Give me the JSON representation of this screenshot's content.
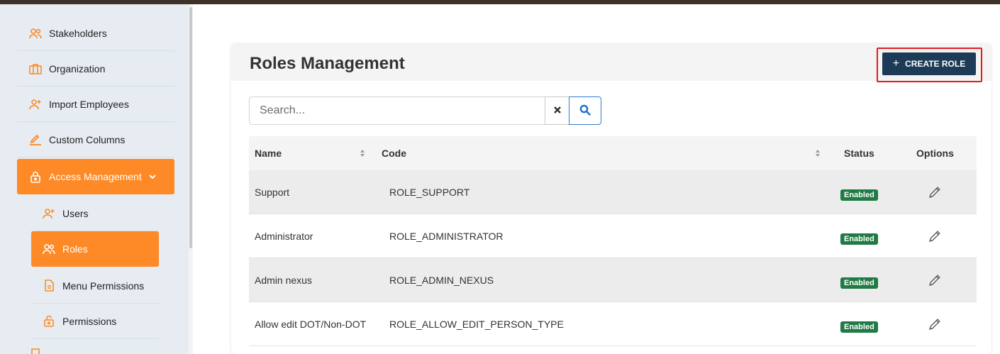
{
  "sidebar": {
    "items": [
      {
        "label": "Stakeholders",
        "icon": "users-icon"
      },
      {
        "label": "Organization",
        "icon": "briefcase-icon"
      },
      {
        "label": "Import Employees",
        "icon": "user-plus-icon"
      },
      {
        "label": "Custom Columns",
        "icon": "pencil-icon"
      },
      {
        "label": "Access Management",
        "icon": "lock-icon"
      },
      {
        "label": "Users",
        "icon": "user-plus-icon"
      },
      {
        "label": "Roles",
        "icon": "users-icon"
      },
      {
        "label": "Menu Permissions",
        "icon": "document-icon"
      },
      {
        "label": "Permissions",
        "icon": "unlock-icon"
      }
    ]
  },
  "page": {
    "title": "Roles Management",
    "create_label": "CREATE ROLE"
  },
  "search": {
    "placeholder": "Search...",
    "value": ""
  },
  "table": {
    "headers": {
      "name": "Name",
      "code": "Code",
      "status": "Status",
      "options": "Options"
    },
    "rows": [
      {
        "name": "Support",
        "code": "ROLE_SUPPORT",
        "status": "Enabled"
      },
      {
        "name": "Administrator",
        "code": "ROLE_ADMINISTRATOR",
        "status": "Enabled"
      },
      {
        "name": "Admin nexus",
        "code": "ROLE_ADMIN_NEXUS",
        "status": "Enabled"
      },
      {
        "name": "Allow edit DOT/Non-DOT",
        "code": "ROLE_ALLOW_EDIT_PERSON_TYPE",
        "status": "Enabled"
      }
    ]
  },
  "colors": {
    "accent": "#fd8a26",
    "primary_button": "#1d3a57",
    "highlight": "#e41b1b",
    "status_enabled": "#1f7a43"
  }
}
